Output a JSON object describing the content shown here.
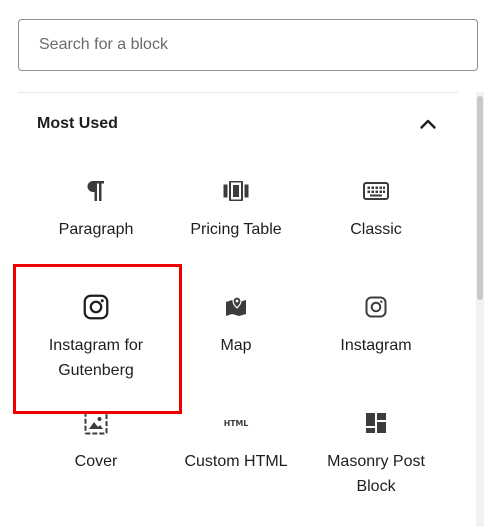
{
  "search": {
    "placeholder": "Search for a block",
    "value": ""
  },
  "panel": {
    "title": "Most Used",
    "expanded": true
  },
  "blocks": [
    {
      "label": "Paragraph",
      "icon": "paragraph-icon"
    },
    {
      "label": "Pricing Table",
      "icon": "pricing-table-icon"
    },
    {
      "label": "Classic",
      "icon": "keyboard-icon"
    },
    {
      "label": "Instagram for Gutenberg",
      "icon": "instagram-icon",
      "highlighted": true
    },
    {
      "label": "Map",
      "icon": "map-icon"
    },
    {
      "label": "Instagram",
      "icon": "instagram-icon"
    },
    {
      "label": "Cover",
      "icon": "cover-image-icon"
    },
    {
      "label": "Custom HTML",
      "icon": "html-icon"
    },
    {
      "label": "Masonry Post Block",
      "icon": "masonry-grid-icon"
    }
  ],
  "colors": {
    "highlight": "#ee0000",
    "icon": "#1e1e1e",
    "border": "#8c8f94"
  }
}
